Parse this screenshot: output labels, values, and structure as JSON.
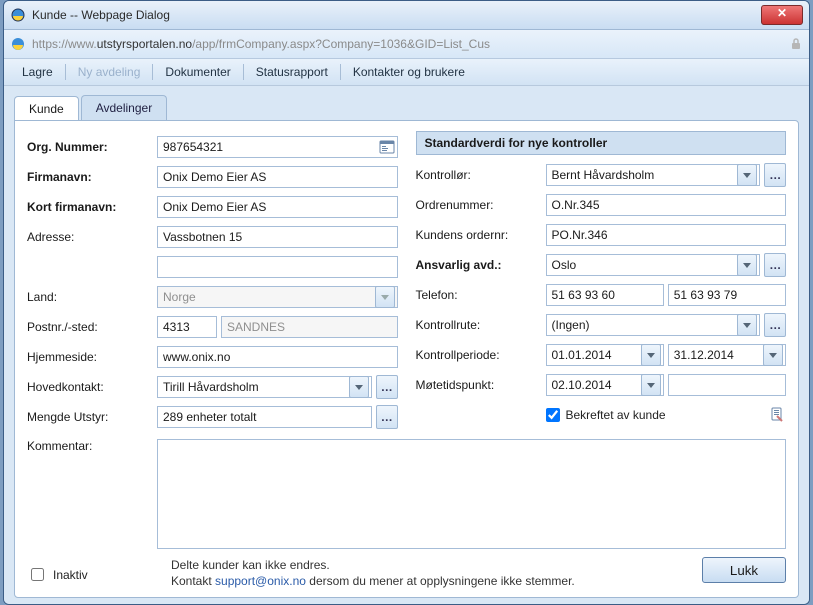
{
  "window": {
    "title": "Kunde -- Webpage Dialog"
  },
  "url": {
    "grey_prefix": "https://www.",
    "host": "utstyrsportalen.no",
    "grey_suffix": "/app/frmCompany.aspx?Company=1036&GID=List_Cus"
  },
  "menu": {
    "lagre": "Lagre",
    "ny_avdeling": "Ny avdeling",
    "dokumenter": "Dokumenter",
    "statusrapport": "Statusrapport",
    "kontakter": "Kontakter og brukere"
  },
  "tabs": {
    "kunde": "Kunde",
    "avdelinger": "Avdelinger"
  },
  "left": {
    "org_label": "Org. Nummer:",
    "org_value": "987654321",
    "firma_label": "Firmanavn:",
    "firma_value": "Onix Demo Eier AS",
    "kort_label": "Kort firmanavn:",
    "kort_value": "Onix Demo Eier AS",
    "adresse_label": "Adresse:",
    "adresse_value": "Vassbotnen 15",
    "adresse2_value": "",
    "land_label": "Land:",
    "land_value": "Norge",
    "post_label": "Postnr./-sted:",
    "post_nr": "4313",
    "post_sted": "SANDNES",
    "hjemmeside_label": "Hjemmeside:",
    "hjemmeside_value": "www.onix.no",
    "hovedkontakt_label": "Hovedkontakt:",
    "hovedkontakt_value": "Tirill Håvardsholm",
    "mengde_label": "Mengde Utstyr:",
    "mengde_value": "289 enheter totalt",
    "kommentar_label": "Kommentar:"
  },
  "right": {
    "section_title": "Standardverdi for nye kontroller",
    "kontrollor_label": "Kontrollør:",
    "kontrollor_value": "Bernt Håvardsholm",
    "ordrenr_label": "Ordrenummer:",
    "ordrenr_value": "O.Nr.345",
    "kundeordre_label": "Kundens ordernr:",
    "kundeordre_value": "PO.Nr.346",
    "ansvarlig_label": "Ansvarlig avd.:",
    "ansvarlig_value": "Oslo",
    "telefon_label": "Telefon:",
    "telefon1": "51 63 93 60",
    "telefon2": "51 63 93 79",
    "rute_label": "Kontrollrute:",
    "rute_value": "(Ingen)",
    "periode_label": "Kontrollperiode:",
    "periode_from": "01.01.2014",
    "periode_to": "31.12.2014",
    "mote_label": "Møtetidspunkt:",
    "mote_value": "02.10.2014",
    "mote_extra": "",
    "bekreftet_label": "Bekreftet av kunde"
  },
  "footer": {
    "inaktiv_label": "Inaktiv",
    "msg_line1": "Delte kunder kan ikke endres.",
    "msg_prefix": "Kontakt ",
    "msg_email": "support@onix.no",
    "msg_suffix": " dersom du mener at opplysningene ikke stemmer.",
    "close_button": "Lukk"
  },
  "glyphs": {
    "dots": "…"
  }
}
